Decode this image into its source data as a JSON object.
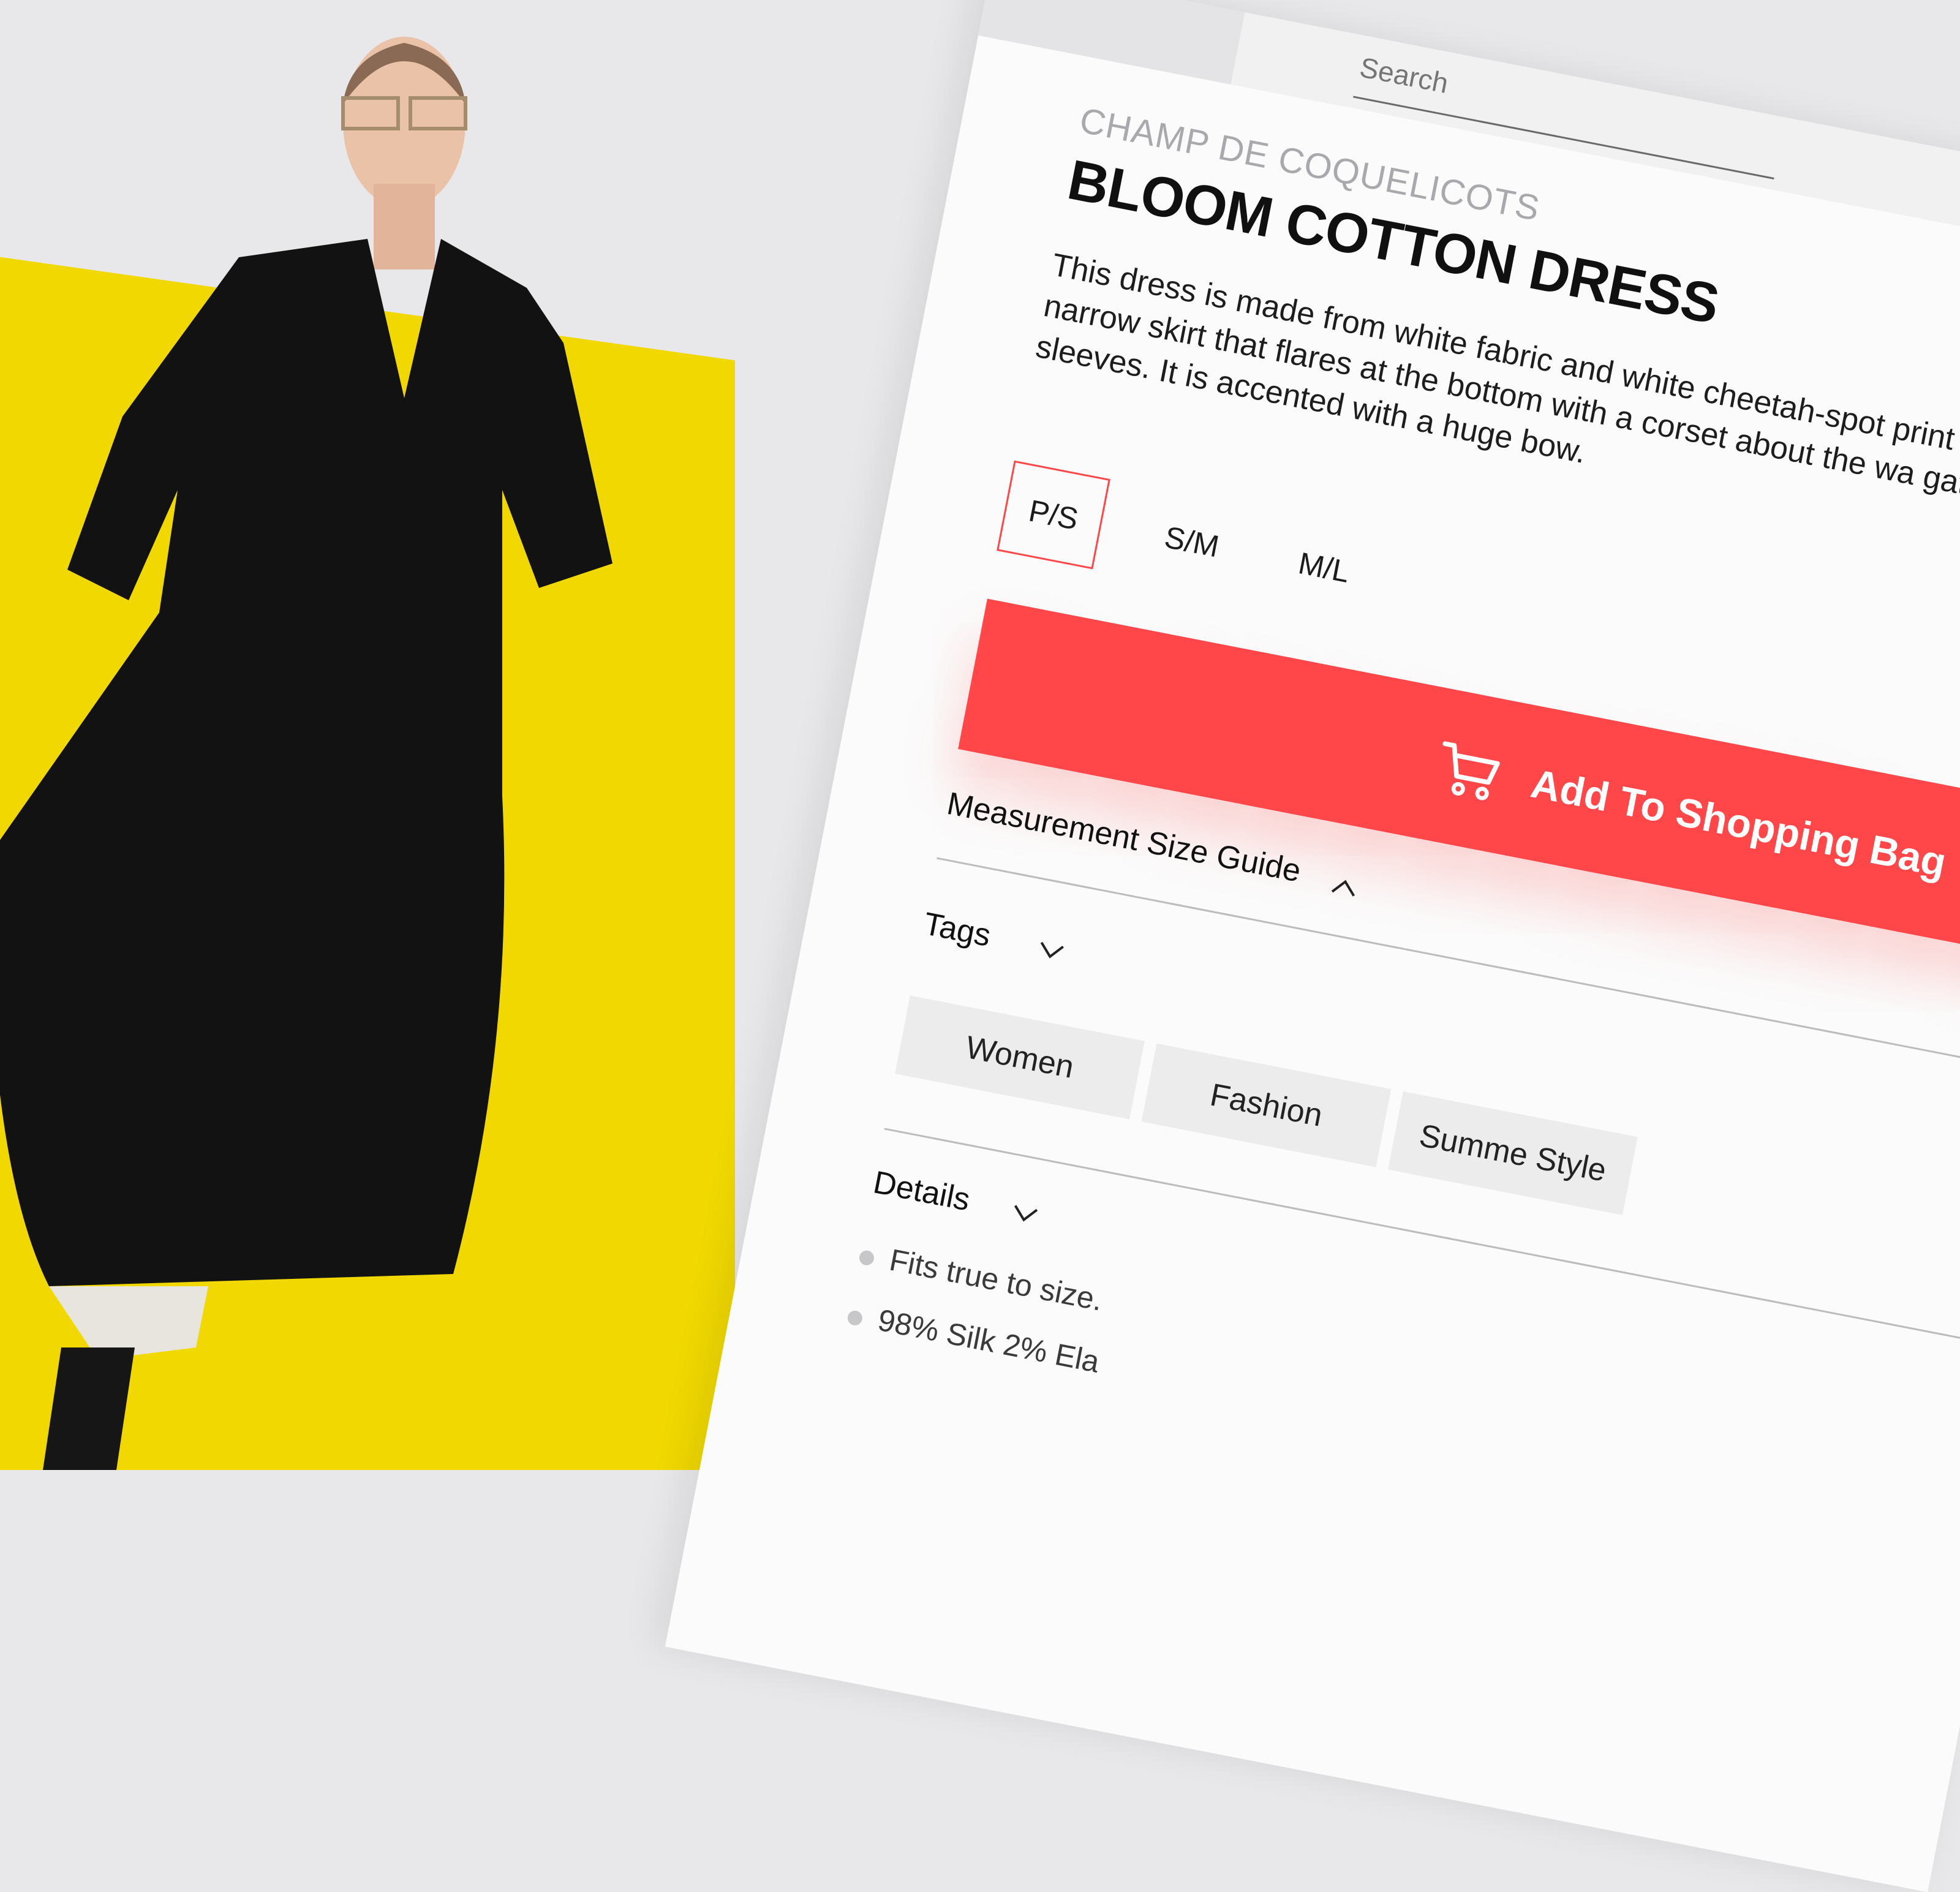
{
  "search": {
    "placeholder": "Search"
  },
  "product": {
    "brand": "CHAMP DE COQUELICOTS",
    "title": "BLOOM COTTON DRESS",
    "description": "This dress is made from white fabric and white cheetah-spot print fa long narrow skirt that flares at the bottom with a corset about the wa gathered sleeves.  It is accented with a huge bow."
  },
  "sizes": {
    "options": [
      "P/S",
      "S/M",
      "M/L"
    ],
    "selected": "P/S"
  },
  "cta": {
    "label": "Add To Shopping Bag",
    "icon": "cart-icon"
  },
  "measurement": {
    "label": "Measurement Size Guide",
    "icon": "chevron-up-icon"
  },
  "tags": {
    "label": "Tags",
    "icon": "chevron-down-icon",
    "items": [
      "Women",
      "Fashion",
      "Summe Style"
    ]
  },
  "details": {
    "label": "Details",
    "icon": "chevron-down-icon",
    "items": [
      "Fits true to size.",
      "98% Silk 2% Ela"
    ]
  },
  "colors": {
    "accent": "#ff474a",
    "hero_yellow": "#f0d800",
    "panel_bg": "#fbfbfb",
    "page_bg": "#e8e8ea"
  }
}
